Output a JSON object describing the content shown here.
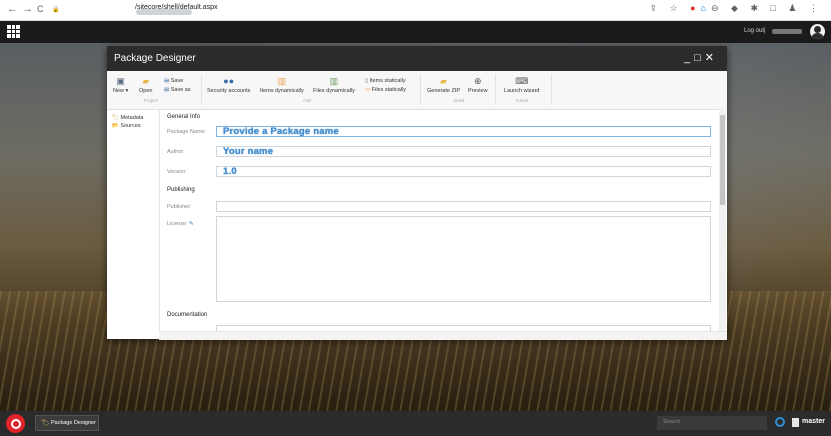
{
  "browser": {
    "nav_back": "←",
    "nav_forward": "→",
    "nav_reload": "C",
    "lock_icon": "🔒",
    "url_path": "/sitecore/shell/default.aspx",
    "toolbar_icons": [
      "share-icon",
      "star-icon",
      "extension-red-icon",
      "extension-icon",
      "extension-icon",
      "extension-icon",
      "puzzle-icon",
      "window-icon",
      "profile-icon",
      "menu-icon"
    ]
  },
  "topbar": {
    "logout_label": "Log out",
    "separator": "|"
  },
  "window": {
    "title": "Package Designer",
    "controls": {
      "minimize": "_",
      "maximize": "□",
      "close": "✕"
    }
  },
  "ribbon": {
    "new_label": "New ▾",
    "open_label": "Open",
    "save_label": "Save",
    "save_as_label": "Save as",
    "group_project": "Project",
    "security_accounts_label": "Security accounts",
    "items_dynamically_label": "Items dynamically",
    "files_dynamically_label": "Files dynamically",
    "items_statically_label": "Items statically",
    "files_statically_label": "Files statically",
    "group_add": "Add",
    "generate_zip_label": "Generate ZIP",
    "preview_label": "Preview",
    "group_build": "Build",
    "launch_wizard_label": "Launch wizard",
    "group_install": "Install"
  },
  "sidebar": {
    "items": [
      {
        "label": "Metadata",
        "icon": "🏷"
      },
      {
        "label": "Sources",
        "icon": "📂"
      }
    ]
  },
  "form": {
    "general_info_heading": "General Info",
    "package_name_label": "Package Name:",
    "package_name_value": "Provide a Package name",
    "author_label": "Author:",
    "author_value": "Your name",
    "version_label": "Version:",
    "version_value": "1.0",
    "publishing_heading": "Publishing",
    "publisher_label": "Publisher:",
    "publisher_value": "",
    "license_label": "License:",
    "license_edit_icon": "✎",
    "documentation_heading": "Documentation"
  },
  "taskbar": {
    "active_app_label": "Package Designer",
    "active_app_icon": "🏷",
    "search_placeholder": "Search",
    "database_label": "master"
  },
  "colors": {
    "accent": "#3f8fd2",
    "titlebar": "#2c2c2c",
    "taskbar": "#2b2b2b",
    "sitecore_red": "#e2232a"
  }
}
